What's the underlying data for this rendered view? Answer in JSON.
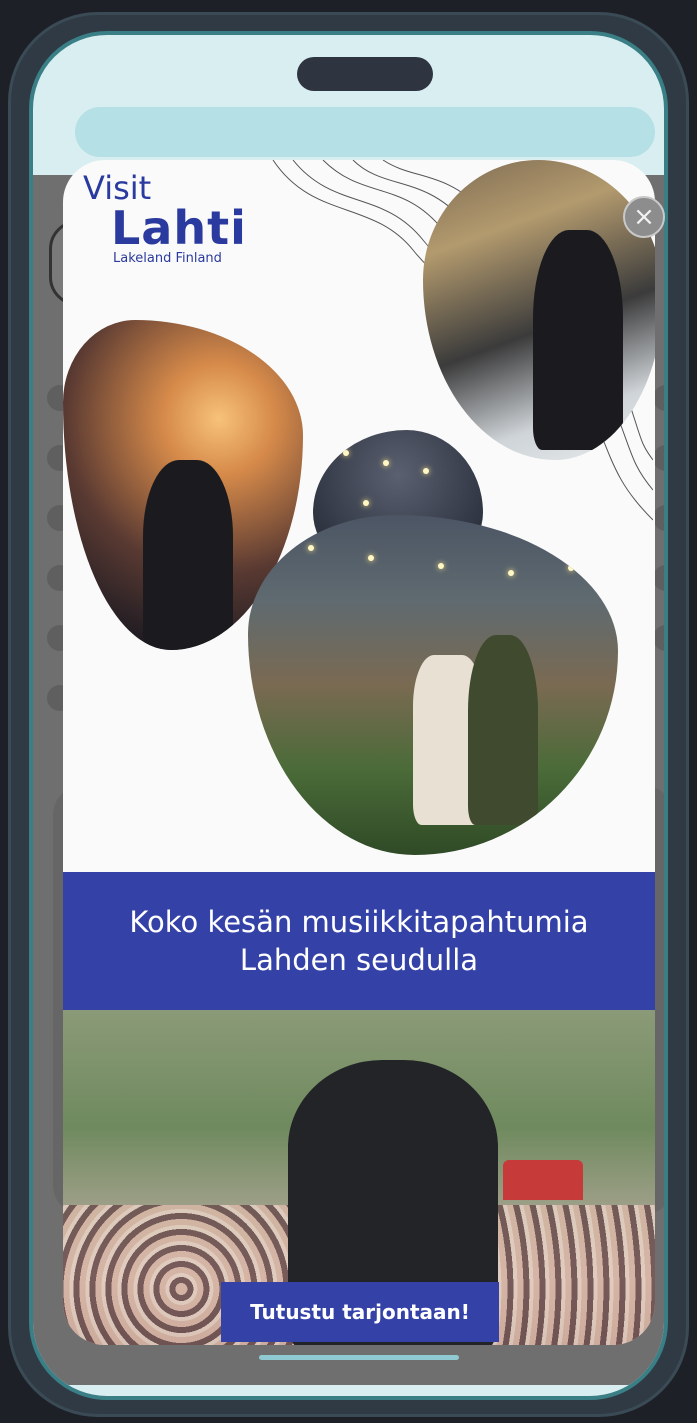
{
  "logo": {
    "visit": "Visit",
    "name": "Lahti",
    "tagline": "Lakeland Finland"
  },
  "modal": {
    "close_icon": "×",
    "headline_line1": "Koko kesän musiikkitapahtumia",
    "headline_line2": "Lahden seudulla",
    "cta_label": "Tutustu tarjontaan!"
  },
  "colors": {
    "brand_blue": "#3442a8",
    "logo_blue": "#2a3a9e",
    "phone_frame": "#d8eef1"
  }
}
